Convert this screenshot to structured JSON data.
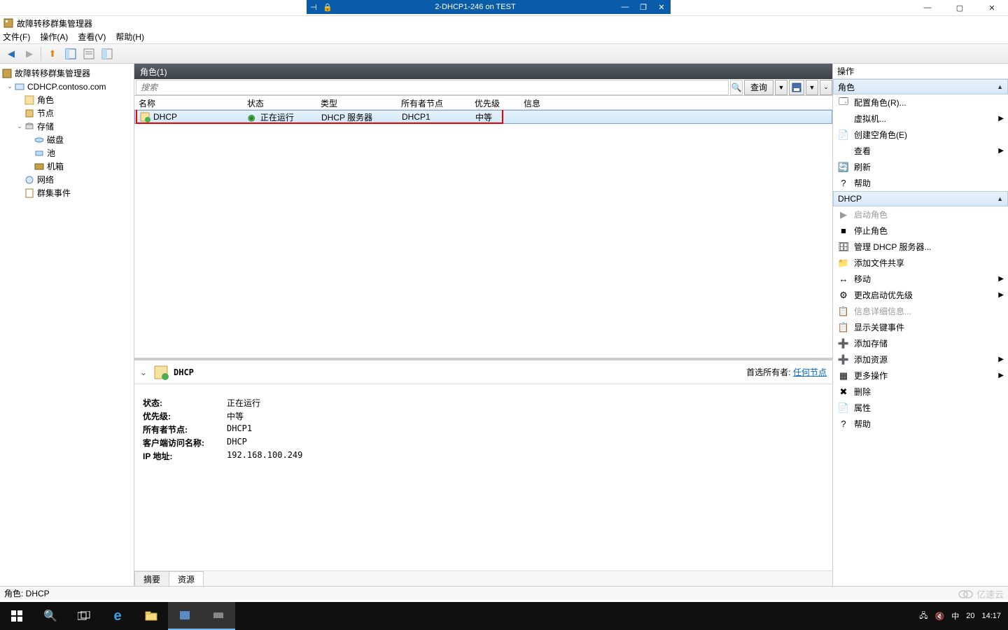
{
  "outer_window": {
    "minimize": "—",
    "maximize": "▢",
    "close": "✕"
  },
  "remote_bar": {
    "title": "2-DHCP1-246 on TEST"
  },
  "window": {
    "title": "故障转移群集管理器"
  },
  "menubar": {
    "file": "文件(F)",
    "action": "操作(A)",
    "view": "查看(V)",
    "help": "帮助(H)"
  },
  "tree": {
    "root": "故障转移群集管理器",
    "cluster": "CDHCP.contoso.com",
    "roles": "角色",
    "nodes": "节点",
    "storage": "存储",
    "disks": "磁盘",
    "pools": "池",
    "chassis": "机箱",
    "networks": "网络",
    "events": "群集事件"
  },
  "center": {
    "header": "角色(1)",
    "search_placeholder": "搜索",
    "query_btn": "查询",
    "columns": {
      "name": "名称",
      "status": "状态",
      "type": "类型",
      "owner": "所有者节点",
      "priority": "优先级",
      "info": "信息"
    },
    "row": {
      "name": "DHCP",
      "status": "正在运行",
      "type": "DHCP 服务器",
      "owner": "DHCP1",
      "priority": "中等",
      "info": ""
    }
  },
  "detail": {
    "title": "DHCP",
    "preferred_owner_label": "首选所有者:",
    "preferred_owner_link": "任何节点",
    "fields": {
      "status_k": "状态:",
      "status_v": "正在运行",
      "priority_k": "优先级:",
      "priority_v": "中等",
      "owner_k": "所有者节点:",
      "owner_v": "DHCP1",
      "client_k": "客户端访问名称:",
      "client_v": "DHCP",
      "ip_k": "IP 地址:",
      "ip_v": "192.168.100.249"
    },
    "tabs": {
      "summary": "摘要",
      "resources": "资源"
    }
  },
  "actions": {
    "header": "操作",
    "section1": "角色",
    "items1": [
      {
        "label": "配置角色(R)...",
        "icon": "🗔"
      },
      {
        "label": "虚拟机...",
        "icon": "",
        "arrow": true
      },
      {
        "label": "创建空角色(E)",
        "icon": "📄"
      },
      {
        "label": "查看",
        "icon": "",
        "arrow": true
      },
      {
        "label": "刷新",
        "icon": "🔄"
      },
      {
        "label": "帮助",
        "icon": "?"
      }
    ],
    "section2": "DHCP",
    "items2": [
      {
        "label": "启动角色",
        "icon": "▶",
        "disabled": true
      },
      {
        "label": "停止角色",
        "icon": "■"
      },
      {
        "label": "管理 DHCP 服务器...",
        "icon": "🗄"
      },
      {
        "label": "添加文件共享",
        "icon": "📁"
      },
      {
        "label": "移动",
        "icon": "↔",
        "arrow": true
      },
      {
        "label": "更改启动优先级",
        "icon": "⚙",
        "arrow": true
      },
      {
        "label": "信息详细信息...",
        "icon": "📋",
        "disabled": true
      },
      {
        "label": "显示关键事件",
        "icon": "📋"
      },
      {
        "label": "添加存储",
        "icon": "➕"
      },
      {
        "label": "添加资源",
        "icon": "➕",
        "arrow": true
      },
      {
        "label": "更多操作",
        "icon": "▦",
        "arrow": true
      },
      {
        "label": "删除",
        "icon": "✖"
      },
      {
        "label": "属性",
        "icon": "📄"
      },
      {
        "label": "帮助",
        "icon": "?"
      }
    ]
  },
  "statusbar": {
    "text": "角色: DHCP"
  },
  "taskbar": {
    "time": "14:17",
    "date": "20",
    "ime": "中",
    "watermark": "亿速云"
  }
}
